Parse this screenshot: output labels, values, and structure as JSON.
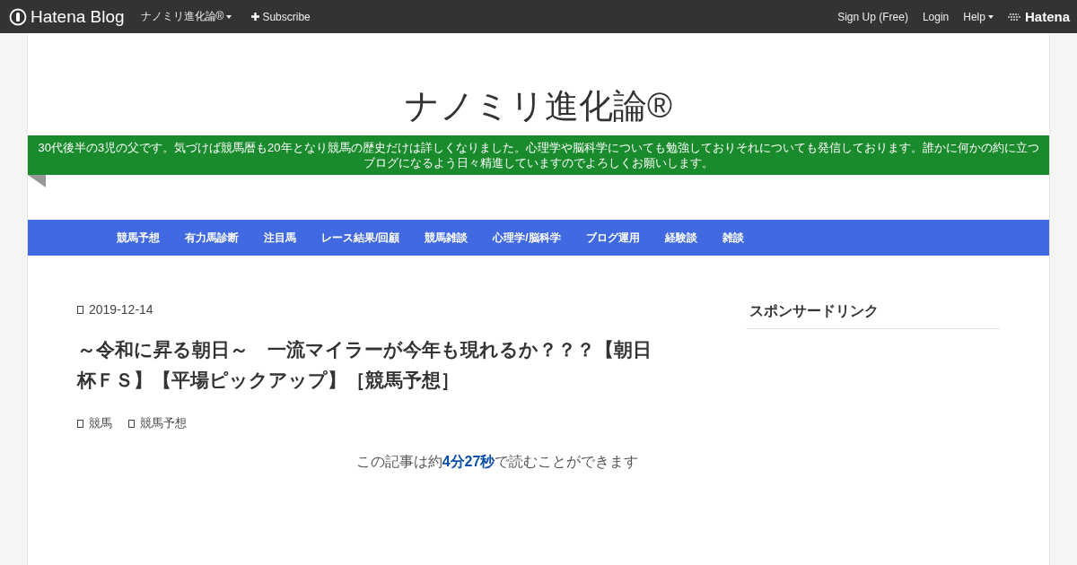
{
  "topbar": {
    "brand": "Hatena Blog",
    "blog_menu": "ナノミリ進化論®",
    "subscribe": "Subscribe",
    "signup": "Sign Up (Free)",
    "login": "Login",
    "help": "Help",
    "hatena": "Hatena"
  },
  "blog": {
    "title": "ナノミリ進化論®",
    "description": "30代後半の3児の父です。気づけば競馬暦も20年となり競馬の歴史だけは詳しくなりました。心理学や脳科学についても勉強しておりそれについても発信しております。誰かに何かの約に立つブログになるよう日々精進していますのでよろしくお願いします。"
  },
  "nav": [
    "競馬予想",
    "有力馬診断",
    "注目馬",
    "レース結果/回顧",
    "競馬雑談",
    "心理学/脳科学",
    "ブログ運用",
    "経験談",
    "雑談"
  ],
  "entry": {
    "date": "2019-12-14",
    "title": "～令和に昇る朝日～　一流マイラーが今年も現れるか？？？【朝日杯ＦＳ】【平場ピックアップ】［競馬予想］",
    "categories": [
      "競馬",
      "競馬予想"
    ],
    "reading_time": "この記事は約**4分27秒**で読むことができます"
  },
  "sidebar": {
    "heading": "スポンサードリンク"
  }
}
